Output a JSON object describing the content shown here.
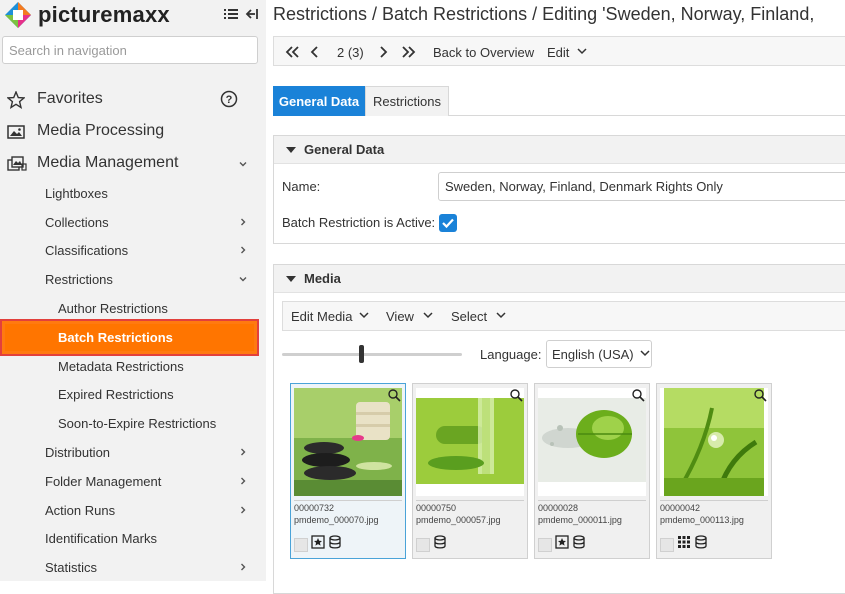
{
  "sidebar": {
    "brand": "picturemaxx",
    "search_placeholder": "Search in navigation",
    "top_items": [
      {
        "label": "Favorites",
        "icon": "star-icon"
      },
      {
        "label": "Media Processing",
        "icon": "image-icon"
      },
      {
        "label": "Media Management",
        "icon": "media-stack-icon"
      }
    ],
    "sub_items": [
      {
        "label": "Lightboxes"
      },
      {
        "label": "Collections"
      },
      {
        "label": "Classifications"
      },
      {
        "label": "Restrictions"
      },
      {
        "label": "Author Restrictions"
      },
      {
        "label": "Batch Restrictions"
      },
      {
        "label": "Metadata Restrictions"
      },
      {
        "label": "Expired Restrictions"
      },
      {
        "label": "Soon-to-Expire Restrictions"
      },
      {
        "label": "Distribution"
      },
      {
        "label": "Folder Management"
      },
      {
        "label": "Action Runs"
      },
      {
        "label": "Identification Marks"
      },
      {
        "label": "Statistics"
      }
    ]
  },
  "header": {
    "title": "Restrictions / Batch Restrictions / Editing 'Sweden, Norway, Finland,"
  },
  "toolbar": {
    "pager": "2 (3)",
    "back_label": "Back to Overview",
    "edit_label": "Edit"
  },
  "tabs": [
    {
      "label": "General Data",
      "active": true
    },
    {
      "label": "Restrictions",
      "active": false
    }
  ],
  "general": {
    "heading": "General Data",
    "name_label": "Name:",
    "name_value": "Sweden, Norway, Finland, Denmark Rights Only",
    "active_label": "Batch Restriction is Active:",
    "active_checked": true
  },
  "media": {
    "heading": "Media",
    "toolbar": {
      "edit_media": "Edit Media",
      "view": "View",
      "select": "Select"
    },
    "language_label": "Language:",
    "language_value": "English (USA)",
    "items": [
      {
        "id": "00000732",
        "file": "pmdemo_000070.jpg",
        "selected": true
      },
      {
        "id": "00000750",
        "file": "pmdemo_000057.jpg",
        "selected": false
      },
      {
        "id": "00000028",
        "file": "pmdemo_000011.jpg",
        "selected": false
      },
      {
        "id": "00000042",
        "file": "pmdemo_000113.jpg",
        "selected": false
      }
    ]
  },
  "colors": {
    "accent_blue": "#1a82d8",
    "active_orange": "#ff7500",
    "highlight_red": "#e2403c"
  }
}
